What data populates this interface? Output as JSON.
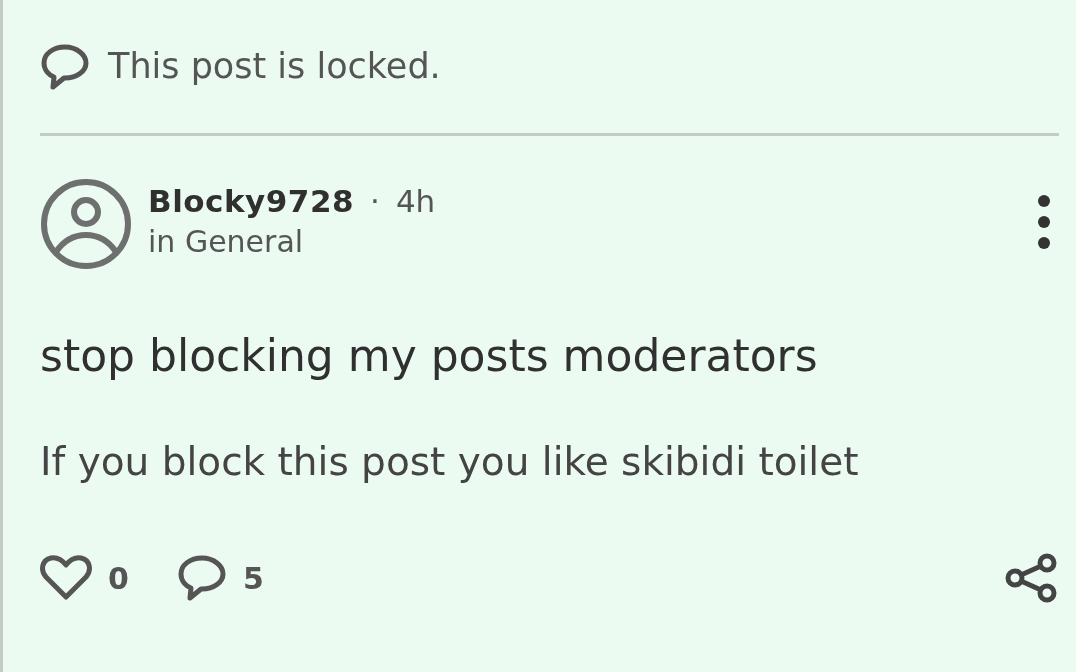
{
  "notice": {
    "text": "This post is locked."
  },
  "post": {
    "author": "Blocky9728",
    "separator": "·",
    "time": "4h",
    "community": "in General",
    "title": "stop blocking my posts moderators",
    "body": "If you block this post you like skibidi toilet"
  },
  "actions": {
    "likes": "0",
    "liked": false,
    "comments": "5"
  }
}
